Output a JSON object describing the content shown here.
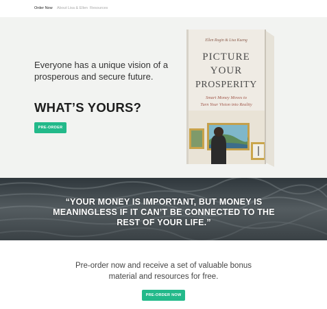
{
  "nav": {
    "items": [
      "Order Now",
      "About Lisa & Ellen",
      "Resources"
    ]
  },
  "hero": {
    "tagline": "Everyone has a unique vision of a prosperous and secure future.",
    "headline": "WHAT’S YOURS?",
    "cta_label": "PRE-ORDER"
  },
  "book": {
    "authors": "Ellen Rogin & Lisa Kueng",
    "title_lines": [
      "PICTURE",
      "YOUR",
      "PROSPERITY"
    ],
    "subtitle_lines": [
      "Smart Money Moves to",
      "Turn Your Vision into Reality"
    ]
  },
  "quote": {
    "text": "“YOUR MONEY IS IMPORTANT, BUT MONEY IS MEANINGLESS IF IT CAN’T BE CONNECTED TO THE REST OF YOUR LIFE.”"
  },
  "footer": {
    "text": "Pre-order now and receive a set of valuable bonus material and resources for free.",
    "cta_label": "PRE-ORDER NOW"
  },
  "colors": {
    "accent": "#23b98a",
    "hero_bg": "#f2f3f1",
    "band_bg": "#4b5256"
  }
}
